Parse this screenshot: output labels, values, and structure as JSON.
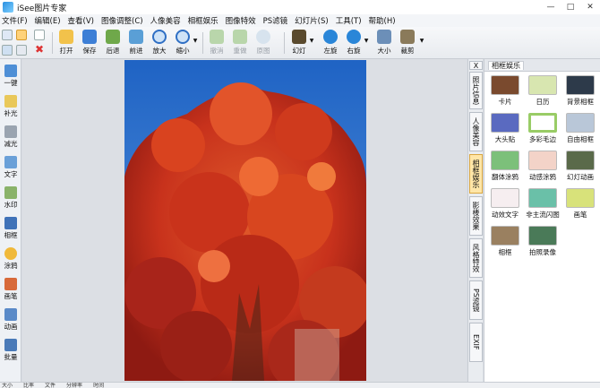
{
  "app": {
    "title": "iSee图片专家"
  },
  "menu": [
    "文件(F)",
    "编辑(E)",
    "查看(V)",
    "图像调整(C)",
    "人像美容",
    "相框娱乐",
    "图像特效",
    "PS滤镜",
    "幻灯片(S)",
    "工具(T)",
    "帮助(H)"
  ],
  "toolbar": {
    "open": "打开",
    "save": "保存",
    "back": "后退",
    "forward": "前进",
    "zoom_in": "放大",
    "zoom_out": "缩小",
    "undo": "撤消",
    "redo": "重做",
    "restore": "原图",
    "slideshow": "幻灯",
    "rotate_left": "左旋",
    "rotate_right": "右旋",
    "size": "大小",
    "crop": "裁剪"
  },
  "left_tools": [
    "一键",
    "补光",
    "减光",
    "文字",
    "水印",
    "相框",
    "涂鸦",
    "画笔",
    "动画",
    "批量"
  ],
  "vtabs": {
    "close": "X",
    "photo_info": "照片信息",
    "beauty": "人像美容",
    "frame_fun": "相框娱乐",
    "shadow": "影楼效果",
    "style": "风格特效",
    "ps_filter": "PS滤镜",
    "exif": "EXIF"
  },
  "panel": {
    "title": "相框娱乐",
    "items": [
      "卡片",
      "日历",
      "背景相框",
      "大头贴",
      "多彩毛边",
      "自由相框",
      "翻体涂鸦",
      "动感涂鸦",
      "幻灯动画",
      "动效文字",
      "非主流闪图",
      "画笔",
      "相框",
      "拍照录像"
    ]
  },
  "status": [
    "大小",
    "比率",
    "文件",
    "分辨率",
    "时间"
  ]
}
